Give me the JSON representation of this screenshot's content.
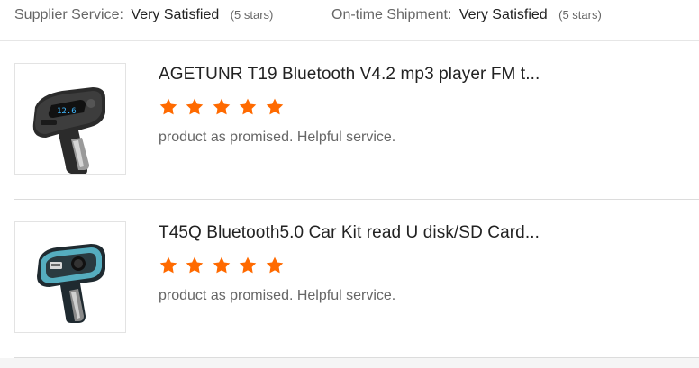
{
  "ratings": [
    {
      "label": "Supplier Service:",
      "value": "Very Satisfied",
      "stars_text": "(5 stars)"
    },
    {
      "label": "On-time Shipment:",
      "value": "Very Satisfied",
      "stars_text": "(5 stars)"
    }
  ],
  "reviews": [
    {
      "title": "AGETUNR T19 Bluetooth V4.2 mp3 player FM t...",
      "rating": 5,
      "comment": "product as promised. Helpful service.",
      "image_icon": "car-fm-transmitter-icon"
    },
    {
      "title": "T45Q Bluetooth5.0 Car Kit read U disk/SD Card...",
      "rating": 5,
      "comment": "product as promised. Helpful service.",
      "image_icon": "car-kit-bluetooth-icon"
    }
  ],
  "colors": {
    "star": "#ff6a00",
    "divider": "#dcdcdc"
  }
}
